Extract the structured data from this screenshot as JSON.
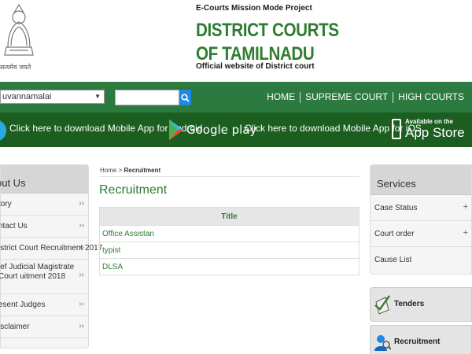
{
  "header": {
    "emblem_caption": "सत्यमेव जयते",
    "project": "E-Courts Mission Mode Project",
    "title": "DISTRICT COURTS OF TAMILNADU",
    "subtitle": "Official website of District court"
  },
  "navbar": {
    "district_value": "uvannamalai",
    "search_placeholder": "",
    "links": [
      "HOME",
      "SUPREME COURT",
      "HIGH COURTS"
    ]
  },
  "appbar": {
    "android_text": "Click here to download Mobile App for Android",
    "google_play": "Google play",
    "ios_text": "Click here to download Mobile App for iOS",
    "appstore_small": "Available on the",
    "appstore_big": "App Store"
  },
  "left_sidebar": {
    "heading": "out Us",
    "items": [
      "tory",
      "ntact Us",
      "istrict Court Recruitment 2017",
      "ief Judicial Magistrate Court uitment 2018",
      "esent Judges",
      "isclaimer"
    ],
    "arrow": "››"
  },
  "main": {
    "breadcrumb_home": "Home",
    "breadcrumb_sep": " > ",
    "breadcrumb_current": "Recruitment",
    "title": "Recruitment",
    "table_header": "Title",
    "rows": [
      "Office Assistan",
      "typist",
      "DLSA"
    ]
  },
  "right_sidebar": {
    "heading": "Services",
    "items": [
      "Case Status",
      "Court order",
      "Cause List"
    ],
    "plus": "+"
  },
  "tiles": [
    "Tenders",
    "Recruitment"
  ],
  "colors": {
    "nav_green": "#2c7a3f",
    "app_green": "#1b5e20",
    "title_green": "#2e7d32",
    "search_blue": "#1e88e5"
  }
}
